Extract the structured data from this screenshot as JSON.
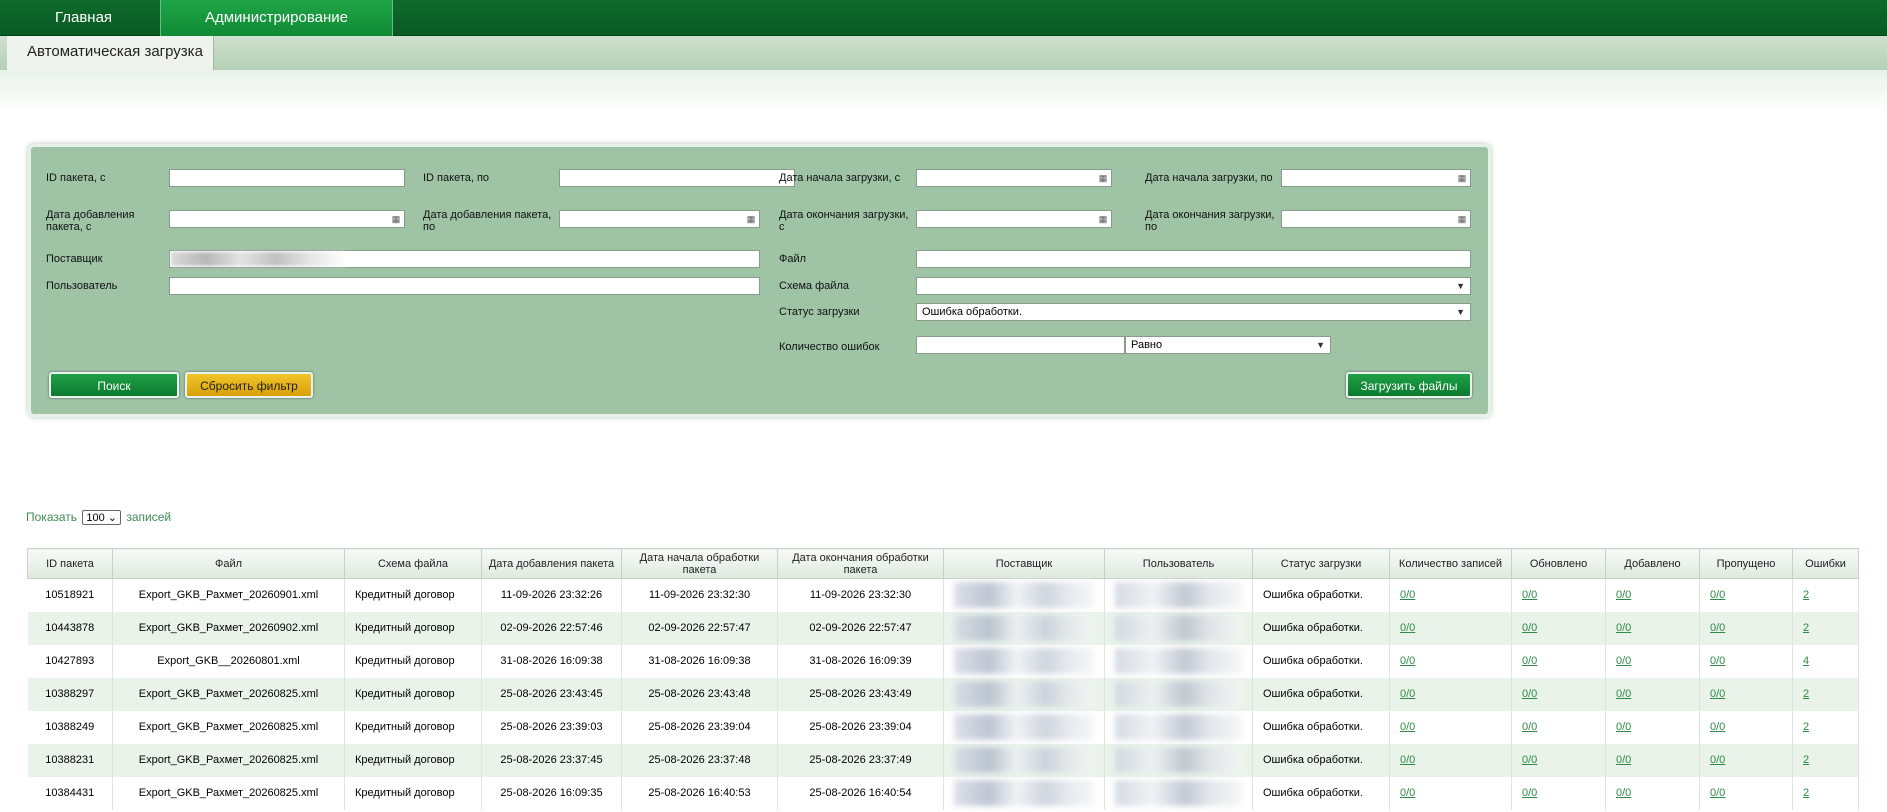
{
  "nav": {
    "home": "Главная",
    "admin": "Администрирование"
  },
  "subtab": "Автоматическая загрузка",
  "filters": {
    "id_from": "ID пакета, с",
    "id_to": "ID пакета, по",
    "start_from": "Дата начала загрузки, с",
    "start_to": "Дата начала загрузки, по",
    "added_from": "Дата добавления пакета, с",
    "added_to": "Дата добавления пакета, по",
    "end_from": "Дата окончания загрузки, с",
    "end_to": "Дата окончания загрузки, по",
    "supplier": "Поставщик",
    "user": "Пользователь",
    "file": "Файл",
    "schema": "Схема файла",
    "status": "Статус загрузки",
    "status_value": "Ошибка обработки.",
    "errors_count": "Количество ошибок",
    "compare_value": "Равно"
  },
  "buttons": {
    "search": "Поиск",
    "reset": "Сбросить фильтр",
    "upload": "Загрузить файлы"
  },
  "show": {
    "prefix": "Показать",
    "value": "100",
    "suffix": "записей"
  },
  "table": {
    "headers": [
      "ID пакета",
      "Файл",
      "Схема файла",
      "Дата добавления пакета",
      "Дата начала обработки пакета",
      "Дата окончания обработки пакета",
      "Поставщик",
      "Пользователь",
      "Статус загрузки",
      "Количество записей",
      "Обновлено",
      "Добавлено",
      "Пропущено",
      "Ошибки"
    ],
    "rows": [
      {
        "id": "10518921",
        "file": "Export_GKB_Рахмет_20260901.xml",
        "schema": "Кредитный договор",
        "added": "11-09-2026 23:32:26",
        "start": "11-09-2026 23:32:30",
        "end": "11-09-2026 23:32:30",
        "status": "Ошибка обработки.",
        "count": "0/0",
        "updated": "0/0",
        "inserted": "0/0",
        "skipped": "0/0",
        "errors": "2"
      },
      {
        "id": "10443878",
        "file": "Export_GKB_Рахмет_20260902.xml",
        "schema": "Кредитный договор",
        "added": "02-09-2026 22:57:46",
        "start": "02-09-2026 22:57:47",
        "end": "02-09-2026 22:57:47",
        "status": "Ошибка обработки.",
        "count": "0/0",
        "updated": "0/0",
        "inserted": "0/0",
        "skipped": "0/0",
        "errors": "2"
      },
      {
        "id": "10427893",
        "file": "Export_GKB__20260801.xml",
        "schema": "Кредитный договор",
        "added": "31-08-2026 16:09:38",
        "start": "31-08-2026 16:09:38",
        "end": "31-08-2026 16:09:39",
        "status": "Ошибка обработки.",
        "count": "0/0",
        "updated": "0/0",
        "inserted": "0/0",
        "skipped": "0/0",
        "errors": "4"
      },
      {
        "id": "10388297",
        "file": "Export_GKB_Рахмет_20260825.xml",
        "schema": "Кредитный договор",
        "added": "25-08-2026 23:43:45",
        "start": "25-08-2026 23:43:48",
        "end": "25-08-2026 23:43:49",
        "status": "Ошибка обработки.",
        "count": "0/0",
        "updated": "0/0",
        "inserted": "0/0",
        "skipped": "0/0",
        "errors": "2"
      },
      {
        "id": "10388249",
        "file": "Export_GKB_Рахмет_20260825.xml",
        "schema": "Кредитный договор",
        "added": "25-08-2026 23:39:03",
        "start": "25-08-2026 23:39:04",
        "end": "25-08-2026 23:39:04",
        "status": "Ошибка обработки.",
        "count": "0/0",
        "updated": "0/0",
        "inserted": "0/0",
        "skipped": "0/0",
        "errors": "2"
      },
      {
        "id": "10388231",
        "file": "Export_GKB_Рахмет_20260825.xml",
        "schema": "Кредитный договор",
        "added": "25-08-2026 23:37:45",
        "start": "25-08-2026 23:37:48",
        "end": "25-08-2026 23:37:49",
        "status": "Ошибка обработки.",
        "count": "0/0",
        "updated": "0/0",
        "inserted": "0/0",
        "skipped": "0/0",
        "errors": "2"
      },
      {
        "id": "10384431",
        "file": "Export_GKB_Рахмет_20260825.xml",
        "schema": "Кредитный договор",
        "added": "25-08-2026 16:09:35",
        "start": "25-08-2026 16:40:53",
        "end": "25-08-2026 16:40:54",
        "status": "Ошибка обработки.",
        "count": "0/0",
        "updated": "0/0",
        "inserted": "0/0",
        "skipped": "0/0",
        "errors": "2"
      }
    ]
  }
}
